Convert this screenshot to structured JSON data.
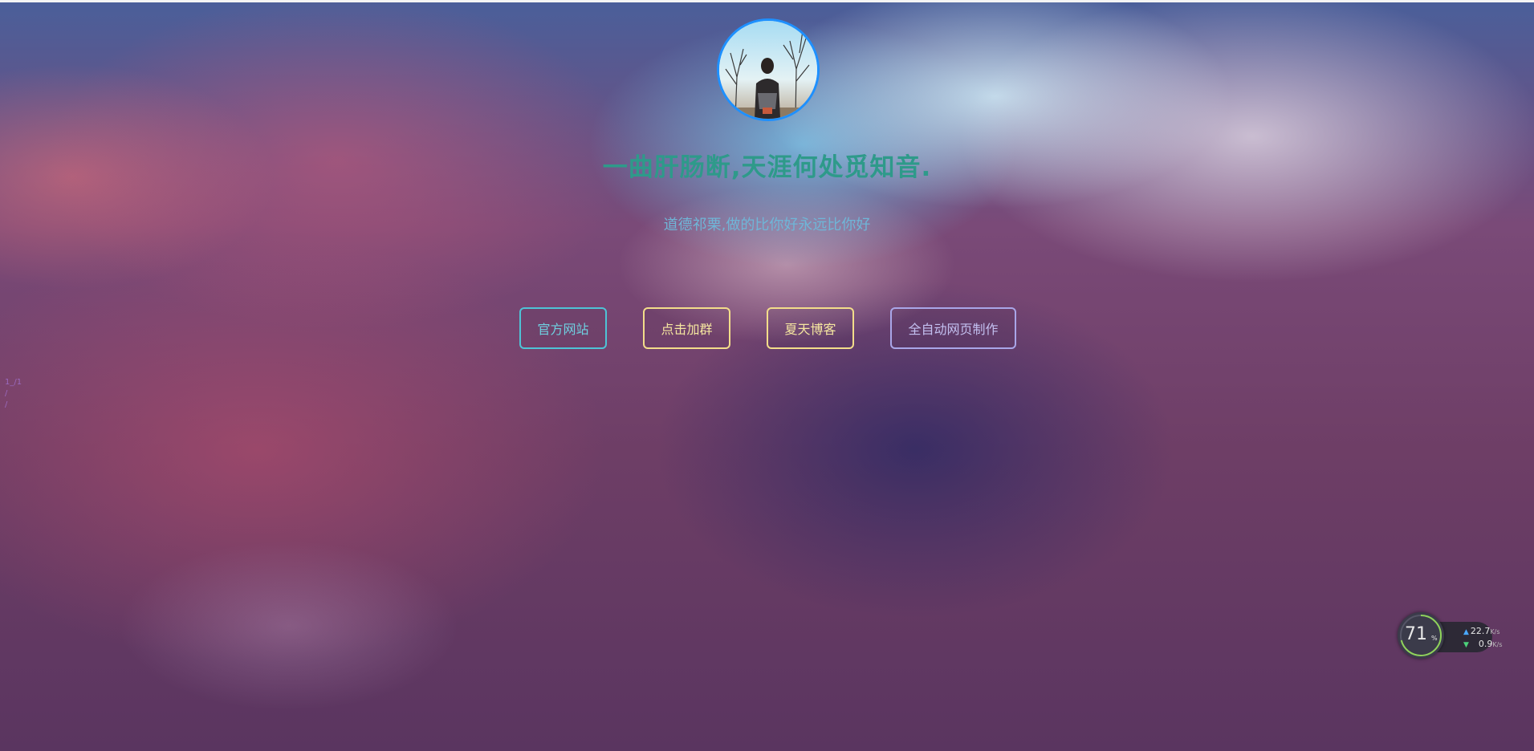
{
  "profile": {
    "avatar_description": "person-standing-by-bare-trees"
  },
  "hero": {
    "title": "一曲肝肠断,天涯何处觅知音.",
    "subtitle": "道德祁栗,做的比你好永远比你好"
  },
  "buttons": [
    {
      "label": "官方网站",
      "color": "#4ec3d6"
    },
    {
      "label": "点击加群",
      "color": "#f3dd8a"
    },
    {
      "label": "夏天博客",
      "color": "#f3dd8a"
    },
    {
      "label": "全自动网页制作",
      "color": "#a9a6e8"
    }
  ],
  "side_marker": {
    "text": "1_/1\n/\n/"
  },
  "net_widget": {
    "percent": "71",
    "percent_unit": "%",
    "percent_value": 0.71,
    "upload": "22.7",
    "upload_unit": "K/s",
    "download": "0.9",
    "download_unit": "K/s",
    "upload_color": "#4aa8ff",
    "download_color": "#4cd27a"
  }
}
